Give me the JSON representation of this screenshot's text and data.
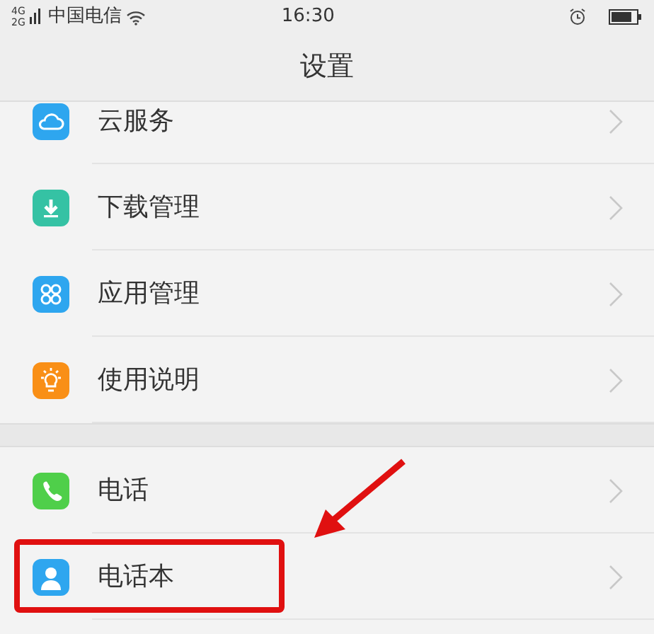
{
  "status_bar": {
    "network_top": "4G",
    "network_bottom": "2G",
    "carrier": "中国电信",
    "time": "16:30"
  },
  "title": "设置",
  "sections": [
    {
      "items": [
        {
          "label": "云服务",
          "kind": "cloud",
          "color": "#2ea6ef"
        },
        {
          "label": "下载管理",
          "kind": "download",
          "color": "#35c2a4"
        },
        {
          "label": "应用管理",
          "kind": "apps",
          "color": "#2ea6ef"
        },
        {
          "label": "使用说明",
          "kind": "bulb",
          "color": "#f98f16"
        }
      ]
    },
    {
      "items": [
        {
          "label": "电话",
          "kind": "phone",
          "color": "#4fcf4a"
        },
        {
          "label": "电话本",
          "kind": "contact",
          "color": "#2ea6ef",
          "highlighted": true
        }
      ]
    }
  ]
}
